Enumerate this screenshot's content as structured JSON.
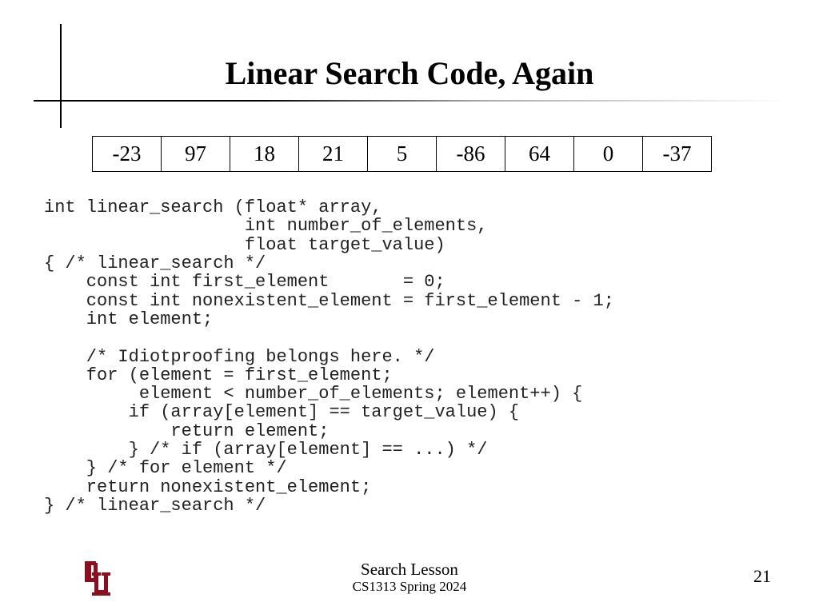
{
  "title": "Linear Search Code, Again",
  "array": [
    "-23",
    "97",
    "18",
    "21",
    "5",
    "-86",
    "64",
    "0",
    "-37"
  ],
  "code": "int linear_search (float* array,\n                   int number_of_elements,\n                   float target_value)\n{ /* linear_search */\n    const int first_element       = 0;\n    const int nonexistent_element = first_element - 1;\n    int element;\n\n    /* Idiotproofing belongs here. */\n    for (element = first_element;\n         element < number_of_elements; element++) {\n        if (array[element] == target_value) {\n            return element;\n        } /* if (array[element] == ...) */\n    } /* for element */\n    return nonexistent_element;\n} /* linear_search */",
  "footer": {
    "lesson": "Search Lesson",
    "course": "CS1313 Spring 2024",
    "page": "21"
  }
}
